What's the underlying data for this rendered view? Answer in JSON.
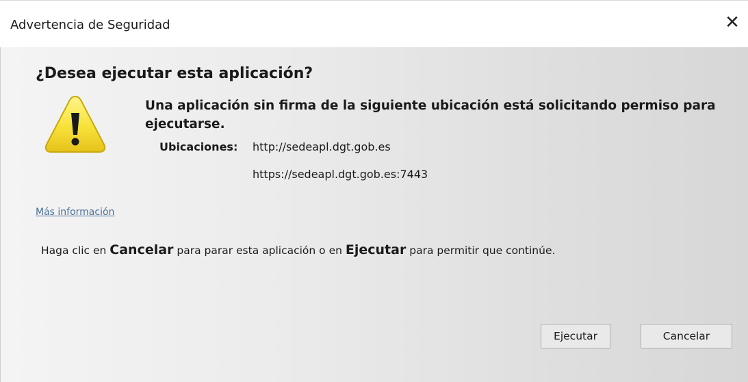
{
  "window": {
    "title": "Advertencia de Seguridad",
    "close_glyph": "✕"
  },
  "dialog": {
    "question": "¿Desea ejecutar esta aplicación?",
    "icon": "warning-icon",
    "message": "Una aplicación sin firma de la siguiente ubicación está solicitando permiso para ejecutarse.",
    "locations_label": "Ubicaciones:",
    "locations": [
      "http://sedeapl.dgt.gob.es",
      "https://sedeapl.dgt.gob.es:7443"
    ],
    "more_info_link": "Más información",
    "instruction": {
      "part1": "Haga clic en ",
      "cancel_word": "Cancelar",
      "part2": " para parar esta aplicación o en ",
      "run_word": "Ejecutar",
      "part3": " para permitir que continúe."
    }
  },
  "buttons": {
    "run": "Ejecutar",
    "cancel": "Cancelar"
  },
  "colors": {
    "warning_fill": "#f7e23a",
    "warning_border": "#c9a90c",
    "link": "#2a5a8a"
  }
}
